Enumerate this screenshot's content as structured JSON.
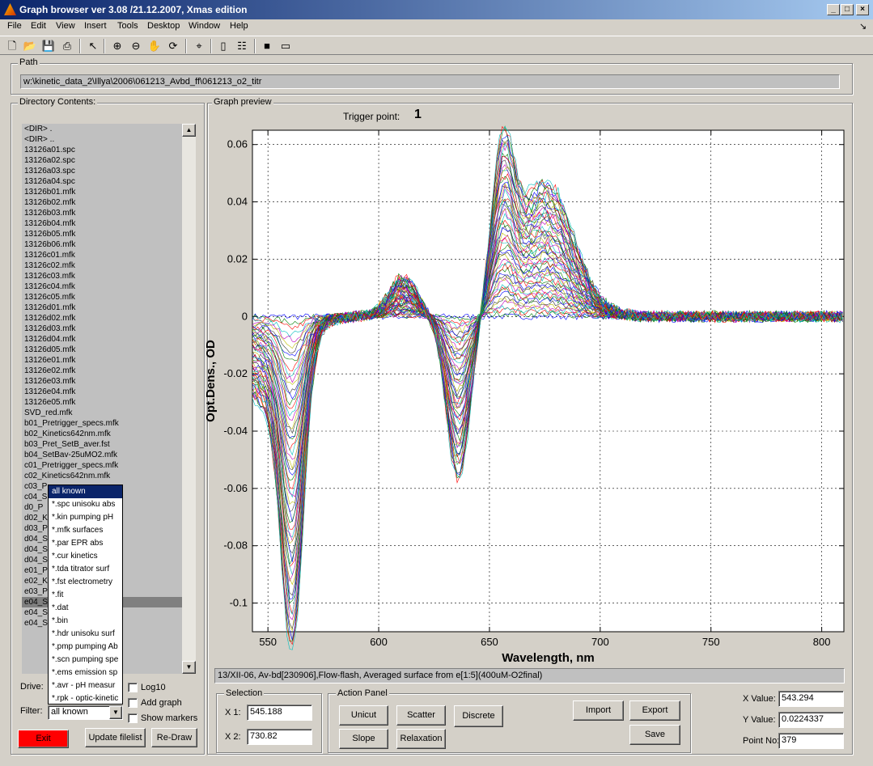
{
  "window": {
    "title": "Graph browser ver 3.08 /21.12.2007, Xmas edition"
  },
  "menu": [
    "File",
    "Edit",
    "View",
    "Insert",
    "Tools",
    "Desktop",
    "Window",
    "Help"
  ],
  "toolbar_icons": [
    "new-file-icon",
    "open-folder-icon",
    "save-icon",
    "print-icon",
    "pointer-icon",
    "zoom-in-icon",
    "zoom-out-icon",
    "pan-hand-icon",
    "rotate-icon",
    "data-cursor-icon",
    "colorbar-icon",
    "legend-icon",
    "hide-plot-tools-icon",
    "show-plot-tools-icon"
  ],
  "path": {
    "label": "Path",
    "value": "w:\\kinetic_data_2\\Illya\\2006\\061213_Avbd_ff\\061213_o2_titr"
  },
  "directory": {
    "label": "Directory Contents:",
    "items": [
      "<DIR>     .",
      "<DIR>     ..",
      "13126a01.spc",
      "13126a02.spc",
      "13126a03.spc",
      "13126a04.spc",
      "13126b01.mfk",
      "13126b02.mfk",
      "13126b03.mfk",
      "13126b04.mfk",
      "13126b05.mfk",
      "13126b06.mfk",
      "13126c01.mfk",
      "13126c02.mfk",
      "13126c03.mfk",
      "13126c04.mfk",
      "13126c05.mfk",
      "13126d01.mfk",
      "13126d02.mfk",
      "13126d03.mfk",
      "13126d04.mfk",
      "13126d05.mfk",
      "13126e01.mfk",
      "13126e02.mfk",
      "13126e03.mfk",
      "13126e04.mfk",
      "13126e05.mfk",
      "SVD_red.mfk",
      "b01_Pretrigger_specs.mfk",
      "b02_Kinetics642nm.mfk",
      "b03_Pret_SetB_aver.fst",
      "b04_SetBav-25uMO2.mfk",
      "c01_Pretrigger_specs.mfk",
      "c02_Kinetics642nm.mfk",
      "c03_P",
      "c04_S                fk",
      "d0_P",
      "d02_K",
      "d03_P",
      "d04_S                fk",
      "d04_S                ak_phase.mfk",
      "d04_S                ak_theory.mfk",
      "e01_P                fk",
      "e02_K",
      "e03_P",
      "e04_S                fk",
      "e04_S                ak_phase.mfk",
      "e04_S                heory.mfk"
    ],
    "selected_index": 45
  },
  "filter_dropdown": {
    "options": [
      "all known",
      "*.spc unisoku abs",
      "*.kin pumping pH",
      "*.mfk surfaces",
      "*.par EPR abs",
      "*.cur kinetics",
      "*.tda titrator surf",
      "*.fst electrometry",
      "*.fit",
      "*.dat",
      "*.bin",
      "*.hdr unisoku surf",
      "*.pmp pumping Ab",
      "*.scn pumping spe",
      "*.ems emission sp",
      "*.avr - pH measur",
      "*.rpk - optic-kinetic"
    ],
    "highlighted_index": 0
  },
  "controls": {
    "drive_label": "Drive:",
    "filter_label": "Filter:",
    "filter_value": "all known",
    "log10": "Log10",
    "add_graph": "Add graph",
    "show_markers": "Show markers",
    "exit": "Exit",
    "update_filelist": "Update filelist",
    "redraw": "Re-Draw"
  },
  "graph": {
    "label": "Graph preview",
    "trigger_label": "Trigger point:",
    "trigger_value": "1",
    "info": "13/XII-06, Av-bd[230906],Flow-flash, Averaged surface from e[1:5](400uM-O2final)"
  },
  "selection": {
    "label": "Selection",
    "x1_label": "X 1:",
    "x1_value": "545.188",
    "x2_label": "X 2:",
    "x2_value": "730.82"
  },
  "action_panel": {
    "label": "Action Panel",
    "unicut": "Unicut",
    "scatter": "Scatter",
    "discrete": "Discrete",
    "slope": "Slope",
    "relaxation": "Relaxation",
    "import": "Import",
    "export": "Export",
    "save": "Save"
  },
  "readout": {
    "x_label": "X Value:",
    "x_value": "543.294",
    "y_label": "Y Value:",
    "y_value": "0.0224337",
    "point_label": "Point No:",
    "point_value": "379"
  },
  "chart_data": {
    "type": "line",
    "xlabel": "Wavelength, nm",
    "ylabel": "Opt.Dens., OD",
    "xlim": [
      543,
      810
    ],
    "ylim": [
      -0.11,
      0.065
    ],
    "xticks": [
      550,
      600,
      650,
      700,
      750,
      800
    ],
    "yticks": [
      -0.1,
      -0.08,
      -0.06,
      -0.04,
      -0.02,
      0,
      0.02,
      0.04,
      0.06
    ],
    "ytick_labels": [
      "-0.1",
      "-0.08",
      "-0.06",
      "-0.04",
      "-0.02",
      "0",
      "0.02",
      "0.04",
      "0.06"
    ],
    "grid": true,
    "series_count": 60,
    "colors": [
      "#0000ff",
      "#008000",
      "#ff0000",
      "#00bfbf",
      "#bf00bf",
      "#bfbf00",
      "#404040"
    ]
  }
}
